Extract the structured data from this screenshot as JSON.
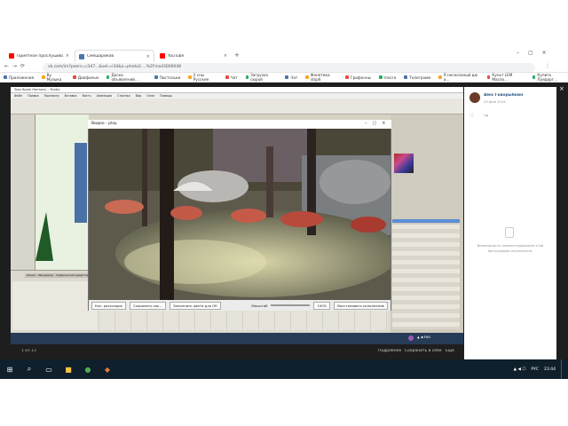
{
  "browser": {
    "tabs": [
      {
        "label": "Приятное прослушиван – YouTube",
        "color": "#ff0000"
      },
      {
        "label": "Смешариков",
        "color": "#4a76a8"
      },
      {
        "label": "YouTube",
        "color": "#ff0000"
      }
    ],
    "url": "vk.com/im?peers=c347...&sel=c34&z=photo2....%2Fmail3000048",
    "bookmarks": [
      "Приложения",
      "Ву Музыка",
      "Диафильм",
      "Доска объявлений...",
      "Пистольки",
      "2 сны Русские",
      "Чат",
      "Загрузка сюрой",
      "Чат",
      "Фонетика stop6",
      "Грифонны",
      "mocrа",
      "Телеграмм",
      "Я несказаный дю а...",
      "Культ LEM Масло...",
      "Купить Луидорг..."
    ]
  },
  "app": {
    "title": "Toon Boom Harmony – Studio",
    "menu": [
      "Файл",
      "Правка",
      "Просмотр",
      "Вставка",
      "Кисть",
      "Анимация",
      "Стрелка",
      "Вид",
      "Окна",
      "Помощь"
    ],
    "timeline_tabs": [
      "Линии",
      "Менеджер",
      "Графический редактор"
    ]
  },
  "playback": {
    "title": "Видео - play",
    "buttons": [
      "Кол. раскладок",
      "Сохранить как...",
      "Заполнить цвета для ОК"
    ],
    "zoom_label": "Масштаб",
    "zoom_value": "100%",
    "fit_label": "Восстановить исполнение"
  },
  "vk": {
    "author": "Alex Говорыбкин",
    "date": "23 фев 2019",
    "note": "Возможность комментирования этой фотографии ограничена.",
    "counter": "1 из 13",
    "actions": [
      "Подробнее",
      "Сохранить в себе",
      "Ещё"
    ]
  },
  "taskbar": {
    "time": "23:44",
    "lang": "РУС"
  }
}
